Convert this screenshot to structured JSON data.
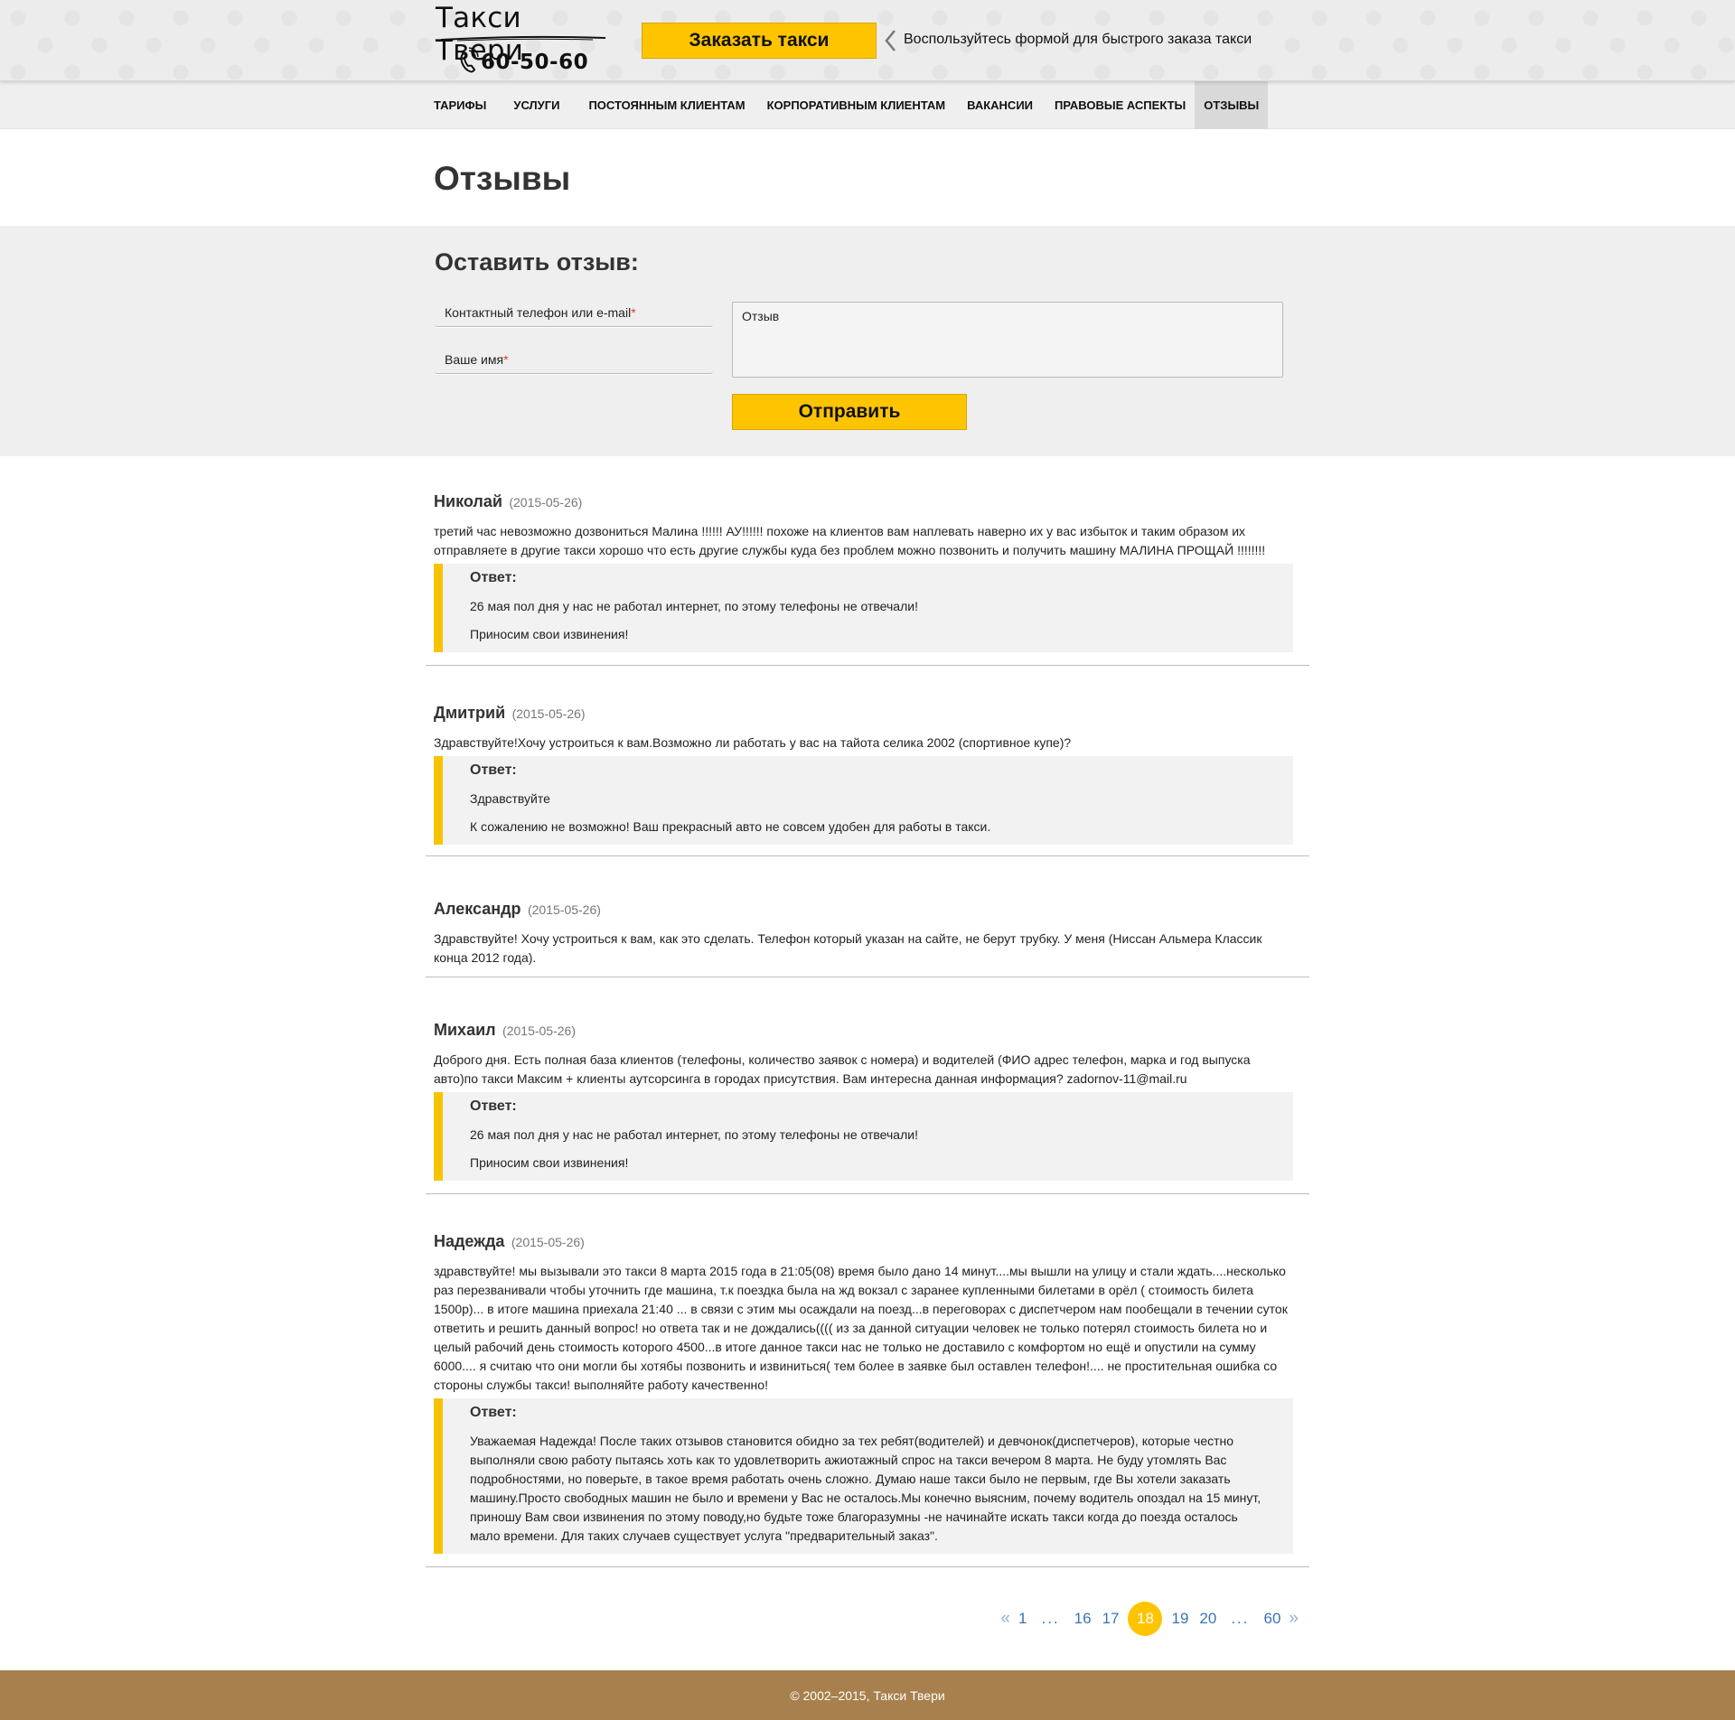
{
  "header": {
    "logo_title": "Такси Твери",
    "logo_phone": "60-50-60",
    "order_button": "Заказать такси",
    "order_hint": "Воспользуйтесь формой для быстрого заказа такси"
  },
  "nav": {
    "items": [
      {
        "label": "ТАРИФЫ",
        "active": false
      },
      {
        "label": "УСЛУГИ",
        "active": false
      },
      {
        "label": "ПОСТОЯННЫМ КЛИЕНТАМ",
        "active": false
      },
      {
        "label": "КОРПОРАТИВНЫМ КЛИЕНТАМ",
        "active": false
      },
      {
        "label": "ВАКАНСИИ",
        "active": false
      },
      {
        "label": "ПРАВОВЫЕ АСПЕКТЫ",
        "active": false
      },
      {
        "label": "ОТЗЫВЫ",
        "active": true
      }
    ]
  },
  "page": {
    "title": "Отзывы"
  },
  "form": {
    "title": "Оставить отзыв:",
    "contact_placeholder": "Контактный телефон или e-mail",
    "name_placeholder": "Ваше имя",
    "required_mark": "*",
    "review_placeholder": "Отзыв",
    "submit": "Отправить"
  },
  "reviews": [
    {
      "author": "Николай",
      "date": "(2015-05-26)",
      "text": "третий час невозможно дозвониться Малина !!!!!! АУ!!!!!! похоже на клиентов вам наплевать наверно их у вас избыток и таким образом их отправляете в другие такси хорошо что есть другие службы куда без проблем можно позвонить и получить машину МАЛИНА ПРОЩАЙ !!!!!!!!",
      "answer_label": "Ответ:",
      "answer": [
        "26 мая пол дня у нас не работал интернет, по этому телефоны не отвечали!",
        "Приносим свои извинения!"
      ]
    },
    {
      "author": "Дмитрий",
      "date": "(2015-05-26)",
      "text": "Здравствуйте!Хочу устроиться к вам.Возможно ли работать у вас на тайота селика 2002 (спортивное купе)?",
      "answer_label": "Ответ:",
      "answer": [
        "Здравствуйте",
        "К сожалению не возможно! Ваш прекрасный авто не совсем удобен для работы в такси."
      ]
    },
    {
      "author": "Александр",
      "date": "(2015-05-26)",
      "text": "Здравствуйте! Хочу устроиться к вам, как это сделать. Телефон который указан на сайте, не берут трубку. У меня (Ниссан Альмера Классик конца 2012 года).",
      "answer_label": "",
      "answer": []
    },
    {
      "author": "Михаил",
      "date": "(2015-05-26)",
      "text": "Доброго дня. Есть полная база клиентов (телефоны, количество заявок с номера) и водителей (ФИО адрес телефон, марка и год выпуска авто)по такси Максим + клиенты аутсорсинга в городах присутствия. Вам интересна данная информация? zadornov-11@mail.ru",
      "answer_label": "Ответ:",
      "answer": [
        "26 мая пол дня у нас не работал интернет, по этому телефоны не отвечали!",
        "Приносим свои извинения!"
      ]
    },
    {
      "author": "Надежда",
      "date": "(2015-05-26)",
      "text": "здравствуйте! мы вызывали это такси 8 марта 2015 года в 21:05(08) время было дано 14 минут....мы вышли на улицу и стали ждать....несколько раз перезванивали чтобы уточнить где машина, т.к поездка была на жд вокзал с заранее купленными билетами в орёл ( стоимость билета 1500р)... в итоге машина приехала 21:40 ... в связи с этим мы осаждали на поезд...в переговорах с диспетчером нам пообещали в течении суток ответить и решить данный вопрос! но ответа так и не дождались(((( из за данной ситуации человек не только потерял стоимость билета но и целый рабочий день стоимость которого 4500...в итоге данное такси нас не только не доставило с комфортом но ещё и опустили на сумму 6000.... я считаю что они могли бы хотябы позвонить и извиниться( тем более в заявке был оставлен телефон!.... не простительная ошибка со стороны службы такси! выполняйте работу качественно!",
      "answer_label": "Ответ:",
      "answer": [
        "Уважаемая Надежда! После таких отзывов становится обидно за тех ребят(водителей) и девчонок(диспетчеров), которые честно выполняли свою работу пытаясь хоть как то удовлетворить ажиотажный спрос на такси вечером 8 марта. Не буду утомлять Вас подробностями, но поверьте, в такое время работать очень сложно. Думаю наше такси было не первым, где Вы хотели заказать машину.Просто свободных машин не было и времени у Вас не осталось.Мы конечно выясним, почему водитель опоздал на 15 минут, приношу Вам свои извинения по этому поводу,но будьте тоже благоразумны -не начинайте искать такси когда до поезда осталось мало времени. Для таких случаев существует услуга \"предварительный заказ\"."
      ]
    }
  ],
  "pagination": {
    "prev_icon": "«",
    "next_icon": "»",
    "dots": "...",
    "first": "1",
    "pages": [
      "16",
      "17",
      "18",
      "19",
      "20"
    ],
    "current": "18",
    "last": "60"
  },
  "footer": {
    "copyright": "© 2002–2015, Такси Твери"
  },
  "colors": {
    "accent": "#ffc400",
    "footer": "#a8804d",
    "link": "#3a74b5"
  }
}
